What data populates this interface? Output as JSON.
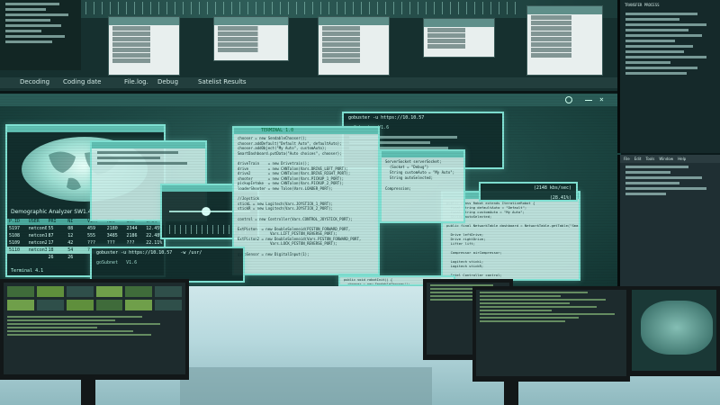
{
  "tabs": {
    "decoding": "Decoding",
    "coding_date": "Coding date",
    "file_log": "File.log.",
    "debug": "Debug",
    "satellite_results": "Satelist Results"
  },
  "analyzer": {
    "title": "Demographic Analyzer",
    "version": "SW1.4",
    "columns": [
      "P.ID",
      "USER",
      "PRI",
      "NI",
      "VIRT",
      "RES",
      "SHR",
      "CPU%"
    ],
    "rows": [
      [
        "5197",
        "netcon0",
        "55",
        "08",
        "459",
        "2180",
        "2344",
        "12.45%"
      ],
      [
        "5108",
        "netcon1",
        "87",
        "12",
        "555",
        "3485",
        "2186",
        "22.48%"
      ],
      [
        "5109",
        "netcon2",
        "17",
        "42",
        "???",
        "???",
        "???",
        "22.11%"
      ],
      [
        "5110",
        "netcon3",
        "18",
        "54",
        "???",
        "???",
        "???",
        "???"
      ],
      [
        "",
        "",
        "26",
        "26",
        "",
        "",
        "",
        ""
      ]
    ],
    "footer": "Terminal 4.1"
  },
  "console_top": {
    "title": "goSubnet   V1.6",
    "prompt": "gobuster -u https://10.10.57"
  },
  "console_bottom": {
    "prompt": "gobuster -u https://10.10.57   -w /usr/",
    "title": "goSubnet   V1.6"
  },
  "ip_readout": "(2148 kbs/sec)",
  "cpu_readout": "(28.41%)",
  "code_panel": {
    "title": "TERMINAL 1.0",
    "lines": [
      "chooser = new SendableChooser();",
      "chooser.addDefault(\"Default Auto\", defaultAuto);",
      "chooser.addObject(\"My Auto\", customAuto);",
      "SmartDashboard.putData(\"Auto choices\", chooser);",
      "",
      "driveTrain    = new Drivetrain();",
      "drive         = new CANTalon(Vars.DRIVE_LEFT_PORT);",
      "drive2        = new CANTalon(Vars.DRIVE_RIGHT_PORT);",
      "shooter       = new CANTalon(Vars.PICKUP_1_PORT);",
      "pickupIntake  = new CANTalon(Vars.PICKUP_2_PORT);",
      "loaderShooter = new Talon(Vars.LOADER_PORT);",
      "",
      "//Joystick",
      "stickL = new Logitech(Vars.JOYSTICK_1_PORT);",
      "stickR = new Logitech(Vars.JOYSTICK_2_PORT);",
      "",
      "control = new Controller(Vars.CONTROL_JOYSTICK_PORT);",
      "",
      "ExtPiston  = new DoubleSolenoid(PISTON_FORWARD_PORT,",
      "               Vars.LIFT_PISTON_REVERSE_PORT);",
      "ExtPiston2 = new DoubleSolenoid(Vars.PISTON_FORWARD_PORT,",
      "               Vars.LOCK_PISTON_REVERSE_PORT);",
      "",
      "gyroSensor = new DigitalInput(1);"
    ]
  },
  "right_panel": {
    "lines": [
      "public class Robot extends IterativeRobot {",
      "  final String defaultAuto = \"Default\";",
      "  final String customAuto = \"My Auto\";",
      "  String autoSelected;",
      "",
      "public final NetworkTable dashboard = NetworkTable.getTable(\"SmartDash\");",
      "",
      "  Drive leftDrive;",
      "  Drive rightDrive;",
      "  Lifter lift;",
      "",
      "  Compressor airCompressor;",
      "",
      "  Logitech stickL;",
      "  Logitech stickR;",
      "",
      "  Intel Controller control;",
      "",
      "  LimitedSpeedController drive;"
    ]
  },
  "mid_panel": {
    "lines": [
      "ServerSocket serverSocket;",
      "  (Socket = \"Debug\")",
      "  String customAuto = \"My Auto\";",
      "  String autoSelected;",
      "",
      "Compression;"
    ]
  },
  "lower_code": {
    "lines": [
      "public void robotInit() {",
      "  chooser = new SendableChooser();",
      "  chooser.addDefault(\"Default Auto\", defaultAuto);",
      "  chooser.addObject(\"My Auto\", customAuto);",
      "  SmartDashboard.putData(\"Auto choices\", chooser);"
    ]
  },
  "right_top_heading": "TRANSFER PROCESS",
  "right_mid_menu": [
    "File",
    "Edit",
    "Tools",
    "Window",
    "Help"
  ]
}
